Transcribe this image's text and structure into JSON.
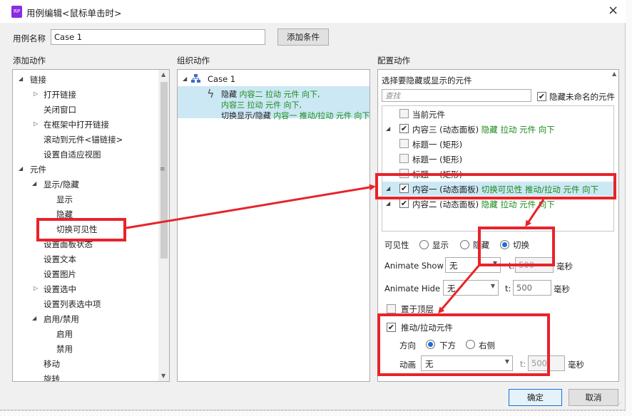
{
  "window": {
    "title": "用例编辑<鼠标单击时>",
    "close": "×",
    "app_icon": "RP"
  },
  "case_name": {
    "label": "用例名称",
    "value": "Case 1",
    "add_condition": "添加条件"
  },
  "add_actions": {
    "title": "添加动作",
    "items": [
      {
        "label": "链接"
      },
      {
        "label": "打开链接"
      },
      {
        "label": "关闭窗口"
      },
      {
        "label": "在框架中打开链接"
      },
      {
        "label": "滚动到元件<锚链接>"
      },
      {
        "label": "设置自适应视图"
      },
      {
        "label": "元件"
      },
      {
        "label": "显示/隐藏"
      },
      {
        "label": "显示"
      },
      {
        "label": "隐藏"
      },
      {
        "label": "切换可见性"
      },
      {
        "label": "设置面板状态"
      },
      {
        "label": "设置文本"
      },
      {
        "label": "设置图片"
      },
      {
        "label": "设置选中"
      },
      {
        "label": "设置列表选中项"
      },
      {
        "label": "启用/禁用"
      },
      {
        "label": "启用"
      },
      {
        "label": "禁用"
      },
      {
        "label": "移动"
      },
      {
        "label": "旋转"
      }
    ]
  },
  "organize": {
    "title": "组织动作",
    "case": "Case 1",
    "action": {
      "l1a": "隐藏 ",
      "l1b": "内容二 拉动 元件 向下,",
      "l2": "内容三 拉动 元件 向下,",
      "l3a": "切换显示/隐藏 ",
      "l3b": "内容一 推动/拉动 元件 向下"
    }
  },
  "configure": {
    "title": "配置动作",
    "select_label": "选择要隐藏或显示的元件",
    "search_placeholder": "查找",
    "hide_unnamed": "隐藏未命名的元件",
    "widgets": [
      {
        "name": "当前元件",
        "status": ""
      },
      {
        "name": "内容三 (动态面板) ",
        "status": "隐藏 拉动 元件 向下"
      },
      {
        "name": "标题一 (矩形)",
        "status": ""
      },
      {
        "name": "标题一 (矩形)",
        "status": ""
      },
      {
        "name": "标题一 (矩形)",
        "status": ""
      },
      {
        "name": "内容一 (动态面板) ",
        "status": "切换可见性 推动/拉动 元件 向下"
      },
      {
        "name": "内容二 (动态面板) ",
        "status": "隐藏 拉动 元件 向下"
      }
    ],
    "visibility": {
      "label": "可见性",
      "show": "显示",
      "hide": "隐藏",
      "toggle": "切换"
    },
    "anim_show": {
      "label": "Animate Show",
      "value": "无",
      "t": "t:",
      "ms": "500",
      "unit": "毫秒"
    },
    "anim_hide": {
      "label": "Animate Hide",
      "value": "无",
      "t": "t:",
      "ms": "500",
      "unit": "毫秒"
    },
    "bring_front": "置于顶层",
    "push_pull": "推动/拉动元件",
    "direction": {
      "label": "方向",
      "down": "下方",
      "right": "右侧"
    },
    "animation": {
      "label": "动画",
      "value": "无",
      "t": "t:",
      "ms": "500",
      "unit": "毫秒"
    }
  },
  "footer": {
    "ok": "确定",
    "cancel": "取消"
  },
  "colors": {
    "accent": "#1a6ed8",
    "highlight": "#cce8f4",
    "annotation": "#e8232a",
    "status_green": "#1a8a1a"
  }
}
